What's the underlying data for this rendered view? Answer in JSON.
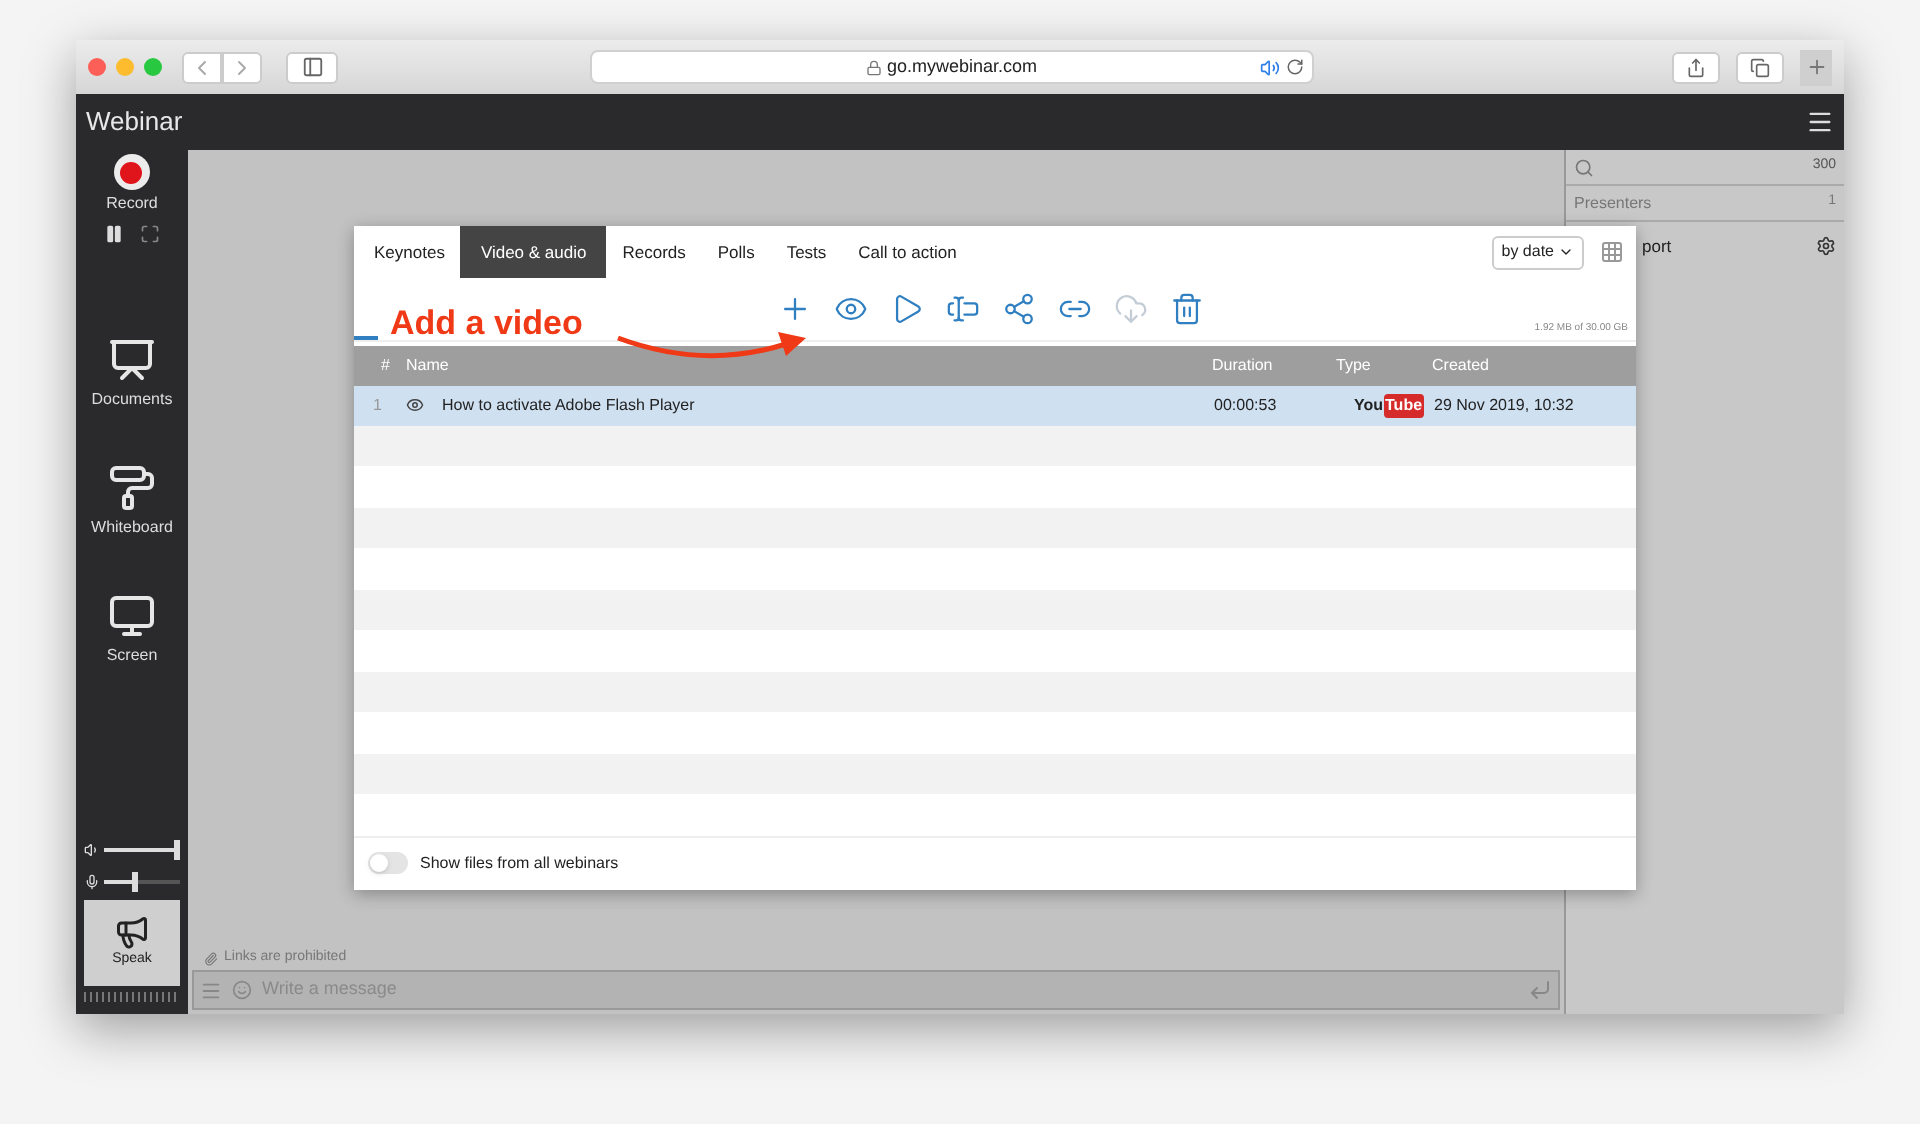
{
  "browser": {
    "url": "go.mywebinar.com"
  },
  "app": {
    "title": "Webinar"
  },
  "sidebar": {
    "record": {
      "label": "Record"
    },
    "items": [
      {
        "kind": "documents",
        "label": "Documents"
      },
      {
        "kind": "whiteboard",
        "label": "Whiteboard"
      },
      {
        "kind": "screen",
        "label": "Screen"
      }
    ],
    "volume": {
      "level": 1.0
    },
    "mic": {
      "level": 0.4
    },
    "speak": {
      "label": "Speak"
    }
  },
  "modal": {
    "tabs": [
      {
        "label": "Keynotes",
        "selected": false
      },
      {
        "label": "Video & audio",
        "selected": true
      },
      {
        "label": "Records",
        "selected": false
      },
      {
        "label": "Polls",
        "selected": false
      },
      {
        "label": "Tests",
        "selected": false
      },
      {
        "label": "Call to action",
        "selected": false
      }
    ],
    "sort": {
      "value": "by date"
    },
    "annotation": {
      "text": "Add a video"
    },
    "toolbar": [
      {
        "kind": "add",
        "disabled": false
      },
      {
        "kind": "view",
        "disabled": false
      },
      {
        "kind": "play",
        "disabled": false
      },
      {
        "kind": "rename",
        "disabled": false
      },
      {
        "kind": "share",
        "disabled": false
      },
      {
        "kind": "link",
        "disabled": false
      },
      {
        "kind": "download",
        "disabled": true
      },
      {
        "kind": "delete",
        "disabled": false
      }
    ],
    "storage": "1.92 MB of 30.00 GB",
    "table": {
      "columns": [
        "#",
        "Name",
        "Duration",
        "Type",
        "Created"
      ],
      "rows": [
        {
          "index": "1",
          "name": "How to activate Adobe Flash Player",
          "duration": "00:00:53",
          "type_logo": [
            "You",
            "Tube"
          ],
          "created": "29 Nov 2019, 10:32",
          "selected": true
        }
      ]
    },
    "footer": {
      "toggle": {
        "label": "Show files from all webinars",
        "on": false
      }
    }
  },
  "right_panel": {
    "search_count": "300",
    "presenters": {
      "label": "Presenters",
      "count": "1"
    },
    "item": {
      "label": "port"
    }
  },
  "chat": {
    "notice": "Links are prohibited",
    "placeholder": "Write a message"
  }
}
